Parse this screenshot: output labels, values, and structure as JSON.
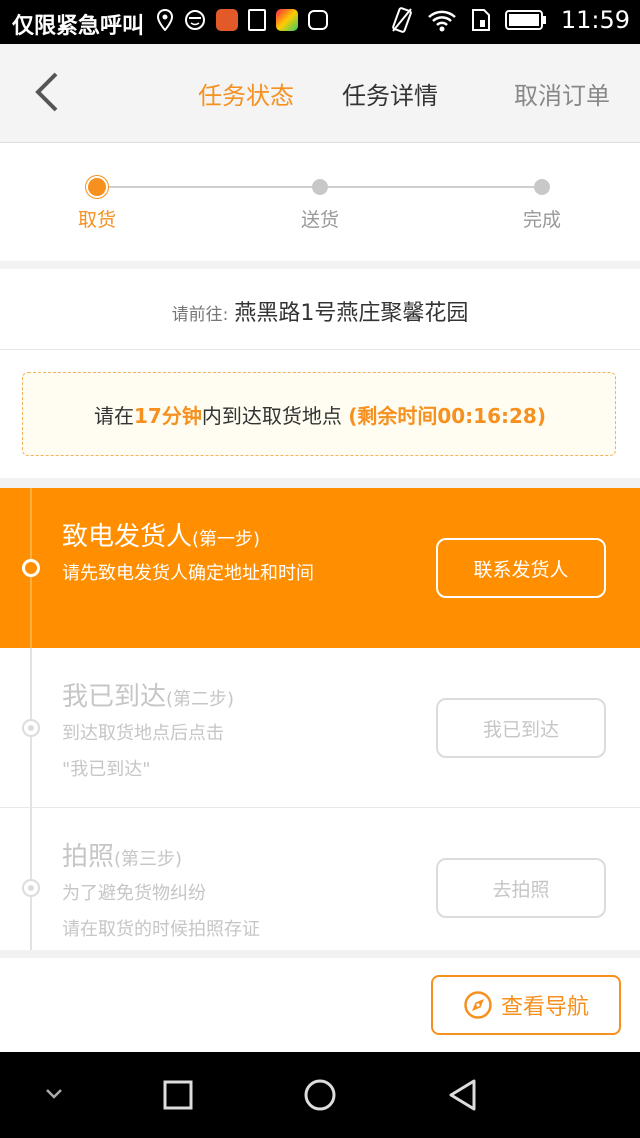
{
  "statusbar": {
    "carrier": "仅限紧急呼叫",
    "time": "11:59"
  },
  "nav": {
    "tab_status": "任务状态",
    "tab_detail": "任务详情",
    "cancel": "取消订单"
  },
  "progress": {
    "steps": [
      "取货",
      "送货",
      "完成"
    ]
  },
  "address": {
    "prefix": "请前往:",
    "value": "燕黑路1号燕庄聚馨花园"
  },
  "timer": {
    "pre": "请在",
    "minutes": "17分钟",
    "mid": "内到达取货地点 ",
    "remaining": "(剩余时间00:16:28)"
  },
  "steps": [
    {
      "title": "致电发货人",
      "sub": "(第一步)",
      "desc1": "请先致电发货人确定地址和时间",
      "desc2": "",
      "button": "联系发货人"
    },
    {
      "title": "我已到达",
      "sub": "(第二步)",
      "desc1": "到达取货地点后点击",
      "desc2": "\"我已到达\"",
      "button": "我已到达"
    },
    {
      "title": "拍照",
      "sub": "(第三步)",
      "desc1": "为了避免货物纠纷",
      "desc2": "请在取货的时候拍照存证",
      "button": "去拍照"
    }
  ],
  "action": {
    "navigate": "查看导航"
  },
  "colors": {
    "accent": "#f6901e",
    "active_step_bg": "#ff8f00",
    "inactive": "#c6c6c6"
  }
}
